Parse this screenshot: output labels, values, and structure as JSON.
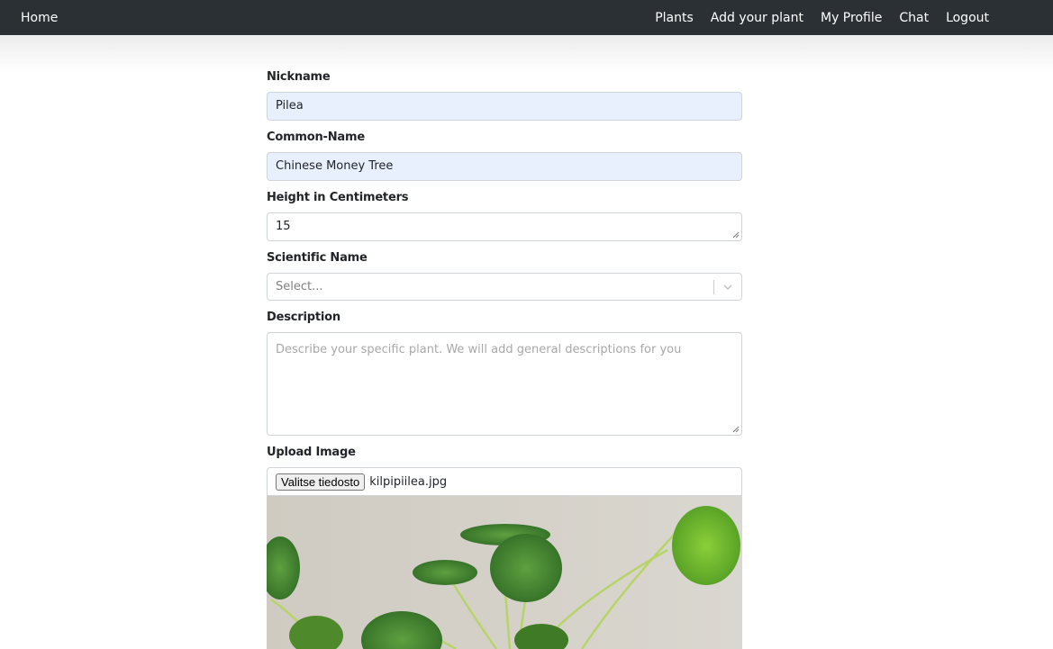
{
  "nav": {
    "home": "Home",
    "links": [
      "Plants",
      "Add your plant",
      "My Profile",
      "Chat",
      "Logout"
    ]
  },
  "form": {
    "nickname_label": "Nickname",
    "nickname_value": "Pilea",
    "common_name_label": "Common-Name",
    "common_name_value": "Chinese Money Tree",
    "height_label": "Height in Centimeters",
    "height_value": "15",
    "scientific_label": "Scientific Name",
    "scientific_placeholder": "Select...",
    "description_label": "Description",
    "description_placeholder": "Describe your specific plant. We will add general descriptions for you",
    "upload_label": "Upload Image",
    "upload_button": "Valitse tiedosto",
    "upload_filename": "kilpipiilea.jpg"
  },
  "colors": {
    "navbar": "#2b3035",
    "autofill": "#e8f0fe",
    "border": "#ced4da"
  }
}
